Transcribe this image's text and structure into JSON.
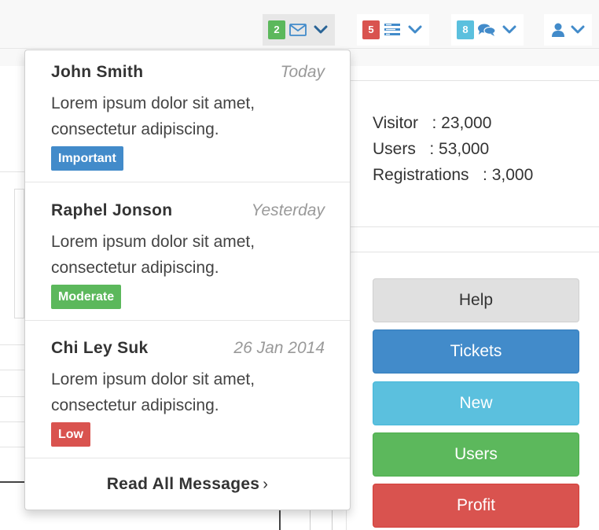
{
  "navbar": {
    "messages": {
      "count": "2",
      "badge_color": "#5cb85c",
      "icon": "envelope-icon"
    },
    "tasks": {
      "count": "5",
      "badge_color": "#d9534f",
      "icon": "tasks-list-icon"
    },
    "alerts": {
      "count": "8",
      "badge_color": "#5bc0de",
      "icon": "comments-icon"
    },
    "user": {
      "icon": "user-icon"
    },
    "accent": "#428bca"
  },
  "dropdown": {
    "messages": [
      {
        "name": "John Smith",
        "time": "Today",
        "text": "Lorem ipsum dolor sit amet, consectetur adipiscing.",
        "label": "Important",
        "label_color": "#428bca"
      },
      {
        "name": "Raphel Jonson",
        "time": "Yesterday",
        "text": "Lorem ipsum dolor sit amet, consectetur adipiscing.",
        "label": "Moderate",
        "label_color": "#5cb85c"
      },
      {
        "name": "Chi Ley Suk",
        "time": "26 Jan 2014",
        "text": "Lorem ipsum dolor sit amet, consectetur adipiscing.",
        "label": "Low",
        "label_color": "#d9534f"
      }
    ],
    "read_all": "Read All Messages",
    "read_all_arrow": "›"
  },
  "stats": [
    {
      "text": "Visitor   : 23,000"
    },
    {
      "text": "Users   : 53,000"
    },
    {
      "text": "Registrations   : 3,000"
    }
  ],
  "buttons": {
    "help": "Help",
    "tickets": "Tickets",
    "new": "New",
    "users": "Users",
    "profit": "Profit"
  }
}
